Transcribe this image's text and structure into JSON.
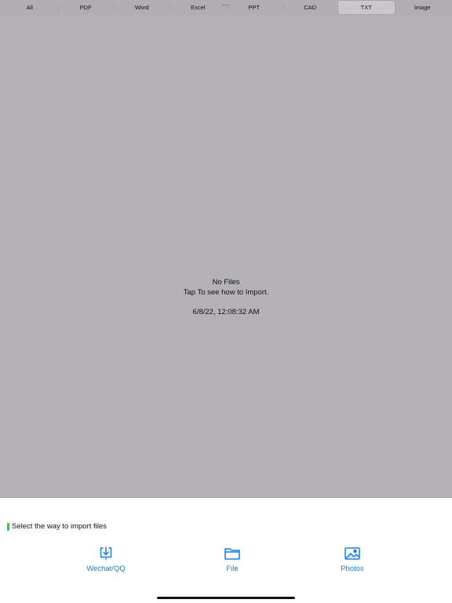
{
  "filter_tabs": [
    {
      "label": "All"
    },
    {
      "label": "PDF"
    },
    {
      "label": "Word"
    },
    {
      "label": "Excel"
    },
    {
      "label": "PPT"
    },
    {
      "label": "CAD"
    },
    {
      "label": "TXT"
    },
    {
      "label": "Image"
    }
  ],
  "active_tab": "TXT",
  "grabber": "***",
  "empty_state": {
    "title": "No Files",
    "hint": "Tap To see how to Import.",
    "timestamp": "6/8/22, 12:08:32 AM"
  },
  "import_sheet": {
    "title": "Select the way to import files",
    "options": [
      {
        "label": "Wechat/QQ",
        "icon": "download-tray-icon"
      },
      {
        "label": "File",
        "icon": "folder-icon"
      },
      {
        "label": "Photos",
        "icon": "photo-icon"
      }
    ]
  },
  "colors": {
    "accent": "#1a7fd8",
    "title_marker": "#34c759",
    "background": "#b4b2b7"
  }
}
